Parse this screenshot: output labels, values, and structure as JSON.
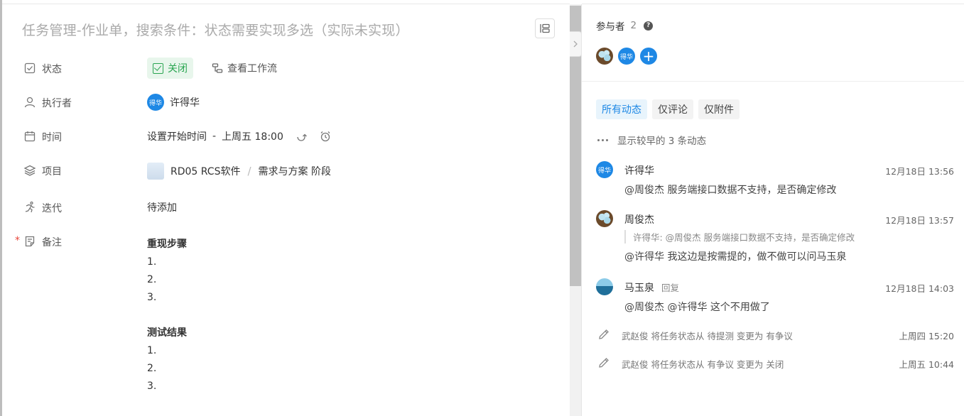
{
  "task": {
    "title": "任务管理-作业单，搜索条件：状态需要实现多选（实际未实现）"
  },
  "fields": {
    "status": {
      "label": "状态",
      "value": "关闭",
      "workflow_link": "查看工作流"
    },
    "assignee": {
      "label": "执行者",
      "avatar_text": "得华",
      "name": "许得华"
    },
    "time": {
      "label": "时间",
      "start_placeholder": "设置开始时间",
      "separator": "-",
      "end": "上周五 18:00"
    },
    "project": {
      "label": "项目",
      "name": "RD05 RCS软件",
      "separator": "/",
      "stage": "需求与方案 阶段"
    },
    "iteration": {
      "label": "迭代",
      "value": "待添加"
    },
    "notes": {
      "label": "备注",
      "required_mark": "*",
      "section1_title": "重现步骤",
      "section1_items": [
        "1.",
        "2.",
        "3."
      ],
      "section2_title": "测试结果",
      "section2_items": [
        "1.",
        "2.",
        "3."
      ]
    }
  },
  "participants": {
    "label": "参与者",
    "count": "2",
    "help": "?",
    "avatars": [
      {
        "name": "周俊杰",
        "style": "egg"
      },
      {
        "name": "许得华",
        "text": "得华",
        "style": "blue"
      }
    ],
    "add": "+"
  },
  "activity": {
    "tabs": [
      "所有动态",
      "仅评论",
      "仅附件"
    ],
    "active_tab": 0,
    "show_earlier": "显示较早的 3 条动态",
    "comments": [
      {
        "author": "许得华",
        "avatar_text": "得华",
        "time": "12月18日 13:56",
        "text": "@周俊杰 服务端接口数据不支持，是否确定修改"
      },
      {
        "author": "周俊杰",
        "time": "12月18日 13:57",
        "quote": "许得华: @周俊杰 服务端接口数据不支持，是否确定修改",
        "text": "@许得华 我这边是按需提的，做不做可以问马玉泉"
      },
      {
        "author": "马玉泉",
        "tag": "回复",
        "time": "12月18日 14:03",
        "text": "@周俊杰 @许得华 这个不用做了"
      }
    ],
    "logs": [
      {
        "text": "武赵俊 将任务状态从 待提测 变更为 有争议",
        "time": "上周四 15:20"
      },
      {
        "text": "武赵俊 将任务状态从 有争议 变更为 关闭",
        "time": "上周五 10:44"
      }
    ]
  },
  "colors": {
    "accent": "#1e88e5",
    "status_green": "#2aa551",
    "status_bg": "#e8f6ec",
    "required_red": "#e8473b"
  }
}
